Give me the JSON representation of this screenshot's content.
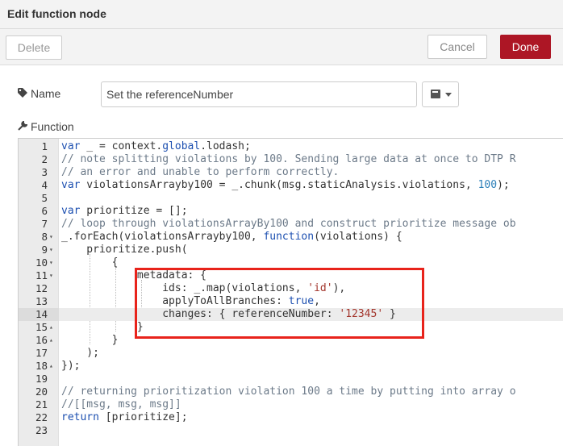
{
  "dialog": {
    "title": "Edit function node"
  },
  "toolbar": {
    "delete_label": "Delete",
    "cancel_label": "Cancel",
    "done_label": "Done"
  },
  "form": {
    "name_label": "Name",
    "name_value": "Set the referenceNumber",
    "function_label": "Function"
  },
  "colors": {
    "done_button": "#ad1625",
    "highlight_box": "#e8231b"
  },
  "editor": {
    "lines": [
      {
        "n": "1",
        "fold": "",
        "code": [
          {
            "t": "var",
            "c": "kw"
          },
          {
            "t": " _ = context.",
            "c": ""
          },
          {
            "t": "global",
            "c": "kw"
          },
          {
            "t": ".lodash;",
            "c": ""
          }
        ]
      },
      {
        "n": "2",
        "fold": "",
        "code": [
          {
            "t": "// note splitting violations by 100. Sending large data at once to DTP R",
            "c": "cm"
          }
        ]
      },
      {
        "n": "3",
        "fold": "",
        "code": [
          {
            "t": "// an error and unable to perform correctly.",
            "c": "cm"
          }
        ]
      },
      {
        "n": "4",
        "fold": "",
        "code": [
          {
            "t": "var",
            "c": "kw"
          },
          {
            "t": " violationsArrayby100 = _.chunk(msg.staticAnalysis.violations, ",
            "c": ""
          },
          {
            "t": "100",
            "c": "num"
          },
          {
            "t": ");",
            "c": ""
          }
        ]
      },
      {
        "n": "5",
        "fold": "",
        "code": []
      },
      {
        "n": "6",
        "fold": "",
        "code": [
          {
            "t": "var",
            "c": "kw"
          },
          {
            "t": " prioritize = [];",
            "c": ""
          }
        ]
      },
      {
        "n": "7",
        "fold": "",
        "code": [
          {
            "t": "// loop through violationsArrayBy100 and construct prioritize message ob",
            "c": "cm"
          }
        ]
      },
      {
        "n": "8",
        "fold": "▾",
        "code": [
          {
            "t": "_.forEach(violationsArrayby100, ",
            "c": ""
          },
          {
            "t": "function",
            "c": "kw"
          },
          {
            "t": "(violations) {",
            "c": ""
          }
        ]
      },
      {
        "n": "9",
        "fold": "▾",
        "code": [
          {
            "t": "    prioritize.push(",
            "c": ""
          }
        ]
      },
      {
        "n": "10",
        "fold": "▾",
        "code": [
          {
            "t": "        {",
            "c": ""
          }
        ]
      },
      {
        "n": "11",
        "fold": "▾",
        "code": [
          {
            "t": "            metadata: {",
            "c": ""
          }
        ]
      },
      {
        "n": "12",
        "fold": "",
        "code": [
          {
            "t": "                ids: _.map(violations, ",
            "c": ""
          },
          {
            "t": "'id'",
            "c": "str"
          },
          {
            "t": "),",
            "c": ""
          }
        ]
      },
      {
        "n": "13",
        "fold": "",
        "code": [
          {
            "t": "                applyToAllBranches: ",
            "c": ""
          },
          {
            "t": "true",
            "c": "kw"
          },
          {
            "t": ",",
            "c": ""
          }
        ]
      },
      {
        "n": "14",
        "fold": "",
        "code": [
          {
            "t": "                changes: { referenceNumber: ",
            "c": ""
          },
          {
            "t": "'12345'",
            "c": "str"
          },
          {
            "t": " }",
            "c": ""
          }
        ]
      },
      {
        "n": "15",
        "fold": "▴",
        "code": [
          {
            "t": "            }",
            "c": ""
          }
        ]
      },
      {
        "n": "16",
        "fold": "▴",
        "code": [
          {
            "t": "        }",
            "c": ""
          }
        ]
      },
      {
        "n": "17",
        "fold": "",
        "code": [
          {
            "t": "    );",
            "c": ""
          }
        ]
      },
      {
        "n": "18",
        "fold": "▴",
        "code": [
          {
            "t": "});",
            "c": ""
          }
        ]
      },
      {
        "n": "19",
        "fold": "",
        "code": []
      },
      {
        "n": "20",
        "fold": "",
        "code": [
          {
            "t": "// returning prioritization violation 100 a time by putting into array o",
            "c": "cm"
          }
        ]
      },
      {
        "n": "21",
        "fold": "",
        "code": [
          {
            "t": "//[[msg, msg, msg]]",
            "c": "cm"
          }
        ]
      },
      {
        "n": "22",
        "fold": "",
        "code": [
          {
            "t": "return",
            "c": "kw"
          },
          {
            "t": " [prioritize];",
            "c": ""
          }
        ]
      },
      {
        "n": "23",
        "fold": "",
        "code": []
      }
    ],
    "active_line": "14"
  }
}
